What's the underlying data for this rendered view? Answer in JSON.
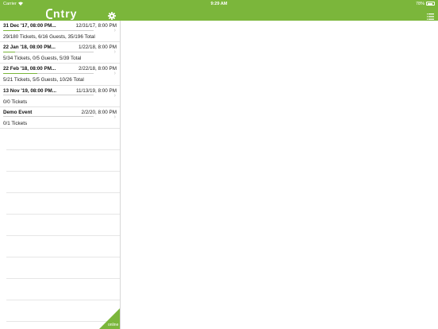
{
  "status_bar": {
    "carrier": "Carrier",
    "time": "9:29 AM",
    "battery": "78%",
    "battery_level": 0.78
  },
  "header": {
    "logo_text": "ntry"
  },
  "events": [
    {
      "title": "31 Dec '17, 08:00 PM...",
      "date": "12/31/17, 8:00 PM",
      "summary": "29/180 Tickets, 6/16 Guests, 35/196 Total",
      "progress": 0.18
    },
    {
      "title": "22 Jan '18, 08:00 PM...",
      "date": "1/22/18, 8:00 PM",
      "summary": "5/34 Tickets, 0/5 Guests, 5/39 Total",
      "progress": 0.13
    },
    {
      "title": "22 Feb '18, 08:00 PM...",
      "date": "2/22/18, 8:00 PM",
      "summary": "5/21 Tickets, 5/5 Guests, 10/26 Total",
      "progress": 0.38
    },
    {
      "title": "13 Nov '19, 08:00 PM...",
      "date": "11/13/19, 8:00 PM",
      "summary": "0/0 Tickets",
      "progress": 0
    },
    {
      "title": "Demo Event",
      "date": "2/2/20, 8:00 PM",
      "summary": "0/1 Tickets",
      "progress": 0
    }
  ],
  "footer": {
    "online_label": "online"
  },
  "colors": {
    "accent": "#7bb63b",
    "divider": "#e3e3e3"
  }
}
